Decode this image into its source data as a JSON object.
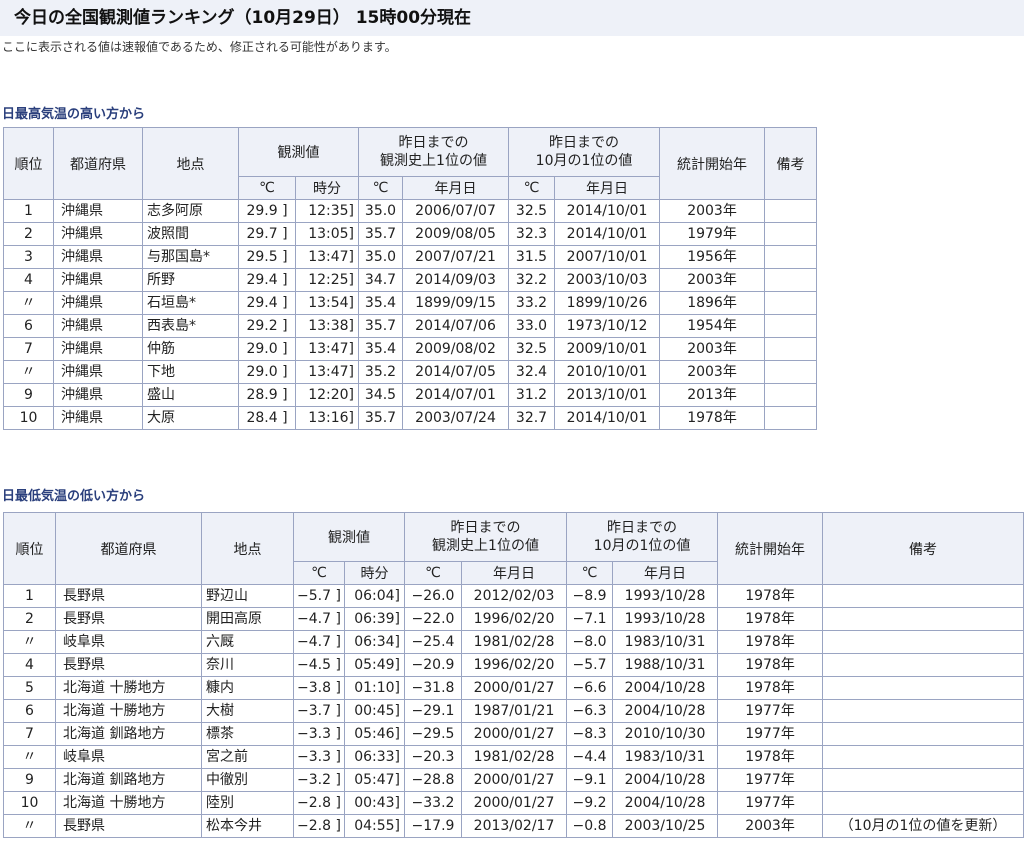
{
  "page": {
    "title": "今日の全国観測値ランキング（10月29日） 15時00分現在",
    "note": "ここに表示される値は速報値であるため、修正される可能性があります。"
  },
  "columns": {
    "rank": "順位",
    "prefecture": "都道府県",
    "location": "地点",
    "observed": "観測値",
    "record_until_yesterday": "昨日までの観測史上1位の値",
    "record_until_yesterday_l1": "昨日までの",
    "record_until_yesterday_l2": "観測史上1位の値",
    "oct_record_l1": "昨日までの",
    "oct_record_l2": "10月の1位の値",
    "stats_start": "統計開始年",
    "remarks": "備考",
    "deg_c": "℃",
    "time": "時分",
    "date": "年月日"
  },
  "high_table": {
    "heading": "日最高気温の高い方から",
    "rows": [
      {
        "rank": "1",
        "pref": "沖縄県",
        "loc": "志多阿原",
        "val": "29.9 ]",
        "time": "12:35]",
        "rec": "35.0",
        "rec_date": "2006/07/07",
        "oct": "32.5",
        "oct_date": "2014/10/01",
        "start": "2003年",
        "remark": ""
      },
      {
        "rank": "2",
        "pref": "沖縄県",
        "loc": "波照間",
        "val": "29.7 ]",
        "time": "13:05]",
        "rec": "35.7",
        "rec_date": "2009/08/05",
        "oct": "32.3",
        "oct_date": "2014/10/01",
        "start": "1979年",
        "remark": ""
      },
      {
        "rank": "3",
        "pref": "沖縄県",
        "loc": "与那国島*",
        "val": "29.5 ]",
        "time": "13:47]",
        "rec": "35.0",
        "rec_date": "2007/07/21",
        "oct": "31.5",
        "oct_date": "2007/10/01",
        "start": "1956年",
        "remark": ""
      },
      {
        "rank": "4",
        "pref": "沖縄県",
        "loc": "所野",
        "val": "29.4 ]",
        "time": "12:25]",
        "rec": "34.7",
        "rec_date": "2014/09/03",
        "oct": "32.2",
        "oct_date": "2003/10/03",
        "start": "2003年",
        "remark": ""
      },
      {
        "rank": "〃",
        "pref": "沖縄県",
        "loc": "石垣島*",
        "val": "29.4 ]",
        "time": "13:54]",
        "rec": "35.4",
        "rec_date": "1899/09/15",
        "oct": "33.2",
        "oct_date": "1899/10/26",
        "start": "1896年",
        "remark": ""
      },
      {
        "rank": "6",
        "pref": "沖縄県",
        "loc": "西表島*",
        "val": "29.2 ]",
        "time": "13:38]",
        "rec": "35.7",
        "rec_date": "2014/07/06",
        "oct": "33.0",
        "oct_date": "1973/10/12",
        "start": "1954年",
        "remark": ""
      },
      {
        "rank": "7",
        "pref": "沖縄県",
        "loc": "仲筋",
        "val": "29.0 ]",
        "time": "13:47]",
        "rec": "35.4",
        "rec_date": "2009/08/02",
        "oct": "32.5",
        "oct_date": "2009/10/01",
        "start": "2003年",
        "remark": ""
      },
      {
        "rank": "〃",
        "pref": "沖縄県",
        "loc": "下地",
        "val": "29.0 ]",
        "time": "13:47]",
        "rec": "35.2",
        "rec_date": "2014/07/05",
        "oct": "32.4",
        "oct_date": "2010/10/01",
        "start": "2003年",
        "remark": ""
      },
      {
        "rank": "9",
        "pref": "沖縄県",
        "loc": "盛山",
        "val": "28.9 ]",
        "time": "12:20]",
        "rec": "34.5",
        "rec_date": "2014/07/01",
        "oct": "31.2",
        "oct_date": "2013/10/01",
        "start": "2013年",
        "remark": ""
      },
      {
        "rank": "10",
        "pref": "沖縄県",
        "loc": "大原",
        "val": "28.4 ]",
        "time": "13:16]",
        "rec": "35.7",
        "rec_date": "2003/07/24",
        "oct": "32.7",
        "oct_date": "2014/10/01",
        "start": "1978年",
        "remark": ""
      }
    ]
  },
  "low_table": {
    "heading": "日最低気温の低い方から",
    "rows": [
      {
        "rank": "1",
        "pref": "長野県",
        "loc": "野辺山",
        "val": "−5.7 ]",
        "time": "06:04]",
        "rec": "−26.0",
        "rec_date": "2012/02/03",
        "oct": "−8.9",
        "oct_date": "1993/10/28",
        "start": "1978年",
        "remark": ""
      },
      {
        "rank": "2",
        "pref": "長野県",
        "loc": "開田高原",
        "val": "−4.7 ]",
        "time": "06:39]",
        "rec": "−22.0",
        "rec_date": "1996/02/20",
        "oct": "−7.1",
        "oct_date": "1993/10/28",
        "start": "1978年",
        "remark": ""
      },
      {
        "rank": "〃",
        "pref": "岐阜県",
        "loc": "六厩",
        "val": "−4.7 ]",
        "time": "06:34]",
        "rec": "−25.4",
        "rec_date": "1981/02/28",
        "oct": "−8.0",
        "oct_date": "1983/10/31",
        "start": "1978年",
        "remark": ""
      },
      {
        "rank": "4",
        "pref": "長野県",
        "loc": "奈川",
        "val": "−4.5 ]",
        "time": "05:49]",
        "rec": "−20.9",
        "rec_date": "1996/02/20",
        "oct": "−5.7",
        "oct_date": "1988/10/31",
        "start": "1978年",
        "remark": ""
      },
      {
        "rank": "5",
        "pref": "北海道 十勝地方",
        "loc": "糠内",
        "val": "−3.8 ]",
        "time": "01:10]",
        "rec": "−31.8",
        "rec_date": "2000/01/27",
        "oct": "−6.6",
        "oct_date": "2004/10/28",
        "start": "1978年",
        "remark": ""
      },
      {
        "rank": "6",
        "pref": "北海道 十勝地方",
        "loc": "大樹",
        "val": "−3.7 ]",
        "time": "00:45]",
        "rec": "−29.1",
        "rec_date": "1987/01/21",
        "oct": "−6.3",
        "oct_date": "2004/10/28",
        "start": "1977年",
        "remark": ""
      },
      {
        "rank": "7",
        "pref": "北海道 釧路地方",
        "loc": "標茶",
        "val": "−3.3 ]",
        "time": "05:46]",
        "rec": "−29.5",
        "rec_date": "2000/01/27",
        "oct": "−8.3",
        "oct_date": "2010/10/30",
        "start": "1977年",
        "remark": ""
      },
      {
        "rank": "〃",
        "pref": "岐阜県",
        "loc": "宮之前",
        "val": "−3.3 ]",
        "time": "06:33]",
        "rec": "−20.3",
        "rec_date": "1981/02/28",
        "oct": "−4.4",
        "oct_date": "1983/10/31",
        "start": "1978年",
        "remark": ""
      },
      {
        "rank": "9",
        "pref": "北海道 釧路地方",
        "loc": "中徹別",
        "val": "−3.2 ]",
        "time": "05:47]",
        "rec": "−28.8",
        "rec_date": "2000/01/27",
        "oct": "−9.1",
        "oct_date": "2004/10/28",
        "start": "1977年",
        "remark": ""
      },
      {
        "rank": "10",
        "pref": "北海道 十勝地方",
        "loc": "陸別",
        "val": "−2.8 ]",
        "time": "00:43]",
        "rec": "−33.2",
        "rec_date": "2000/01/27",
        "oct": "−9.2",
        "oct_date": "2004/10/28",
        "start": "1977年",
        "remark": ""
      },
      {
        "rank": "〃",
        "pref": "長野県",
        "loc": "松本今井",
        "val": "−2.8 ]",
        "time": "04:55]",
        "rec": "−17.9",
        "rec_date": "2013/02/17",
        "oct": "−0.8",
        "oct_date": "2003/10/25",
        "start": "2003年",
        "remark": "（10月の1位の値を更新）"
      }
    ]
  }
}
